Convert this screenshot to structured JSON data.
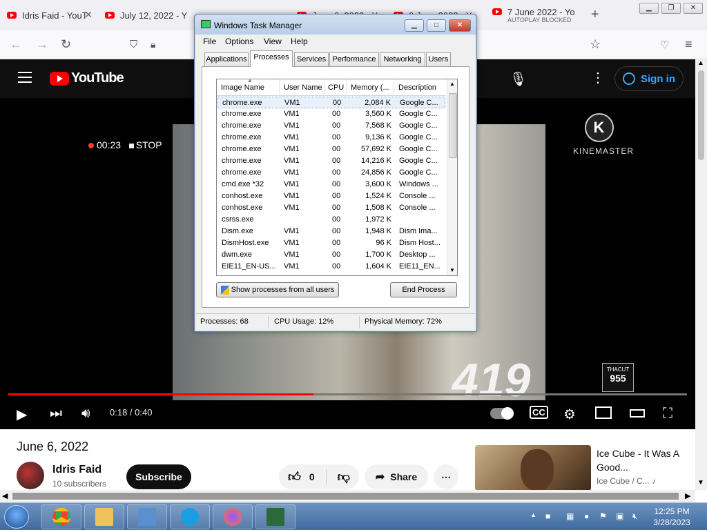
{
  "browser": {
    "tabs": [
      {
        "title": "Idris Faid - YouT",
        "sub": ""
      },
      {
        "title": "July 12, 2022 - Y",
        "sub": ""
      },
      {
        "title": "June 6, 2022 - Y",
        "sub": ""
      },
      {
        "title": "6 June 2022 - Y",
        "sub": ""
      },
      {
        "title": "7 June 2022 - Yo",
        "sub": "AUTOPLAY BLOCKED"
      }
    ],
    "new_tab": "+"
  },
  "youtube": {
    "logo_text": "YouTube",
    "signin": "Sign in",
    "video": {
      "rec_time": "00:23",
      "rec_stop": "STOP",
      "kinemaster": "KINEMASTER",
      "overlay_number": "419",
      "badge": "955",
      "badge_top": "THACUT",
      "time": "0:18 / 0:40",
      "progress": 0.45
    },
    "title": "June 6, 2022",
    "channel": "Idris Faid",
    "subscribers": "10 subscribers",
    "subscribe": "Subscribe",
    "likes": "0",
    "share": "Share",
    "more": "⋯",
    "suggestion": {
      "title": "Ice Cube - It Was A Good...",
      "channel": "Ice Cube / C..."
    }
  },
  "taskmgr": {
    "title": "Windows Task Manager",
    "menu": [
      "File",
      "Options",
      "View",
      "Help"
    ],
    "tabs": [
      "Applications",
      "Processes",
      "Services",
      "Performance",
      "Networking",
      "Users"
    ],
    "active_tab": "Processes",
    "columns": [
      "Image Name",
      "User Name",
      "CPU",
      "Memory (...",
      "Description"
    ],
    "rows": [
      [
        "chrome.exe",
        "VM1",
        "00",
        "2,084 K",
        "Google C..."
      ],
      [
        "chrome.exe",
        "VM1",
        "00",
        "3,560 K",
        "Google C..."
      ],
      [
        "chrome.exe",
        "VM1",
        "00",
        "7,568 K",
        "Google C..."
      ],
      [
        "chrome.exe",
        "VM1",
        "00",
        "9,136 K",
        "Google C..."
      ],
      [
        "chrome.exe",
        "VM1",
        "00",
        "57,692 K",
        "Google C..."
      ],
      [
        "chrome.exe",
        "VM1",
        "00",
        "14,216 K",
        "Google C..."
      ],
      [
        "chrome.exe",
        "VM1",
        "00",
        "24,856 K",
        "Google C..."
      ],
      [
        "cmd.exe *32",
        "VM1",
        "00",
        "3,600 K",
        "Windows ..."
      ],
      [
        "conhost.exe",
        "VM1",
        "00",
        "1,524 K",
        "Console ..."
      ],
      [
        "conhost.exe",
        "VM1",
        "00",
        "1,508 K",
        "Console ..."
      ],
      [
        "csrss.exe",
        "",
        "00",
        "1,972 K",
        ""
      ],
      [
        "Dism.exe",
        "VM1",
        "00",
        "1,948 K",
        "Dism Ima..."
      ],
      [
        "DismHost.exe",
        "VM1",
        "00",
        "96 K",
        "Dism Host..."
      ],
      [
        "dwm.exe",
        "VM1",
        "00",
        "1,700 K",
        "Desktop ..."
      ],
      [
        "EIE11_EN-US...",
        "VM1",
        "00",
        "1,604 K",
        "EIE11_EN..."
      ]
    ],
    "show_all_btn": "Show processes from all users",
    "end_process_btn": "End Process",
    "status": {
      "processes": "Processes: 68",
      "cpu": "CPU Usage: 12%",
      "memory": "Physical Memory: 72%"
    }
  },
  "taskbar": {
    "time": "12:25 PM",
    "date": "3/28/2023"
  }
}
